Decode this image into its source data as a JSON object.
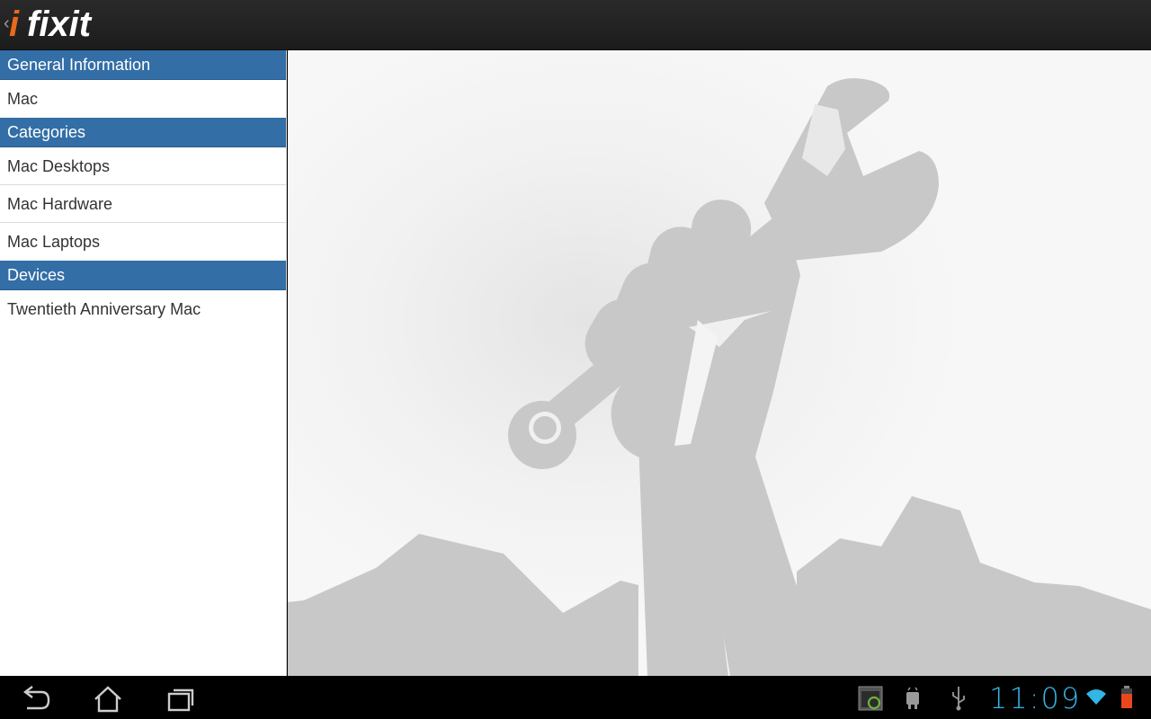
{
  "app": {
    "logo_text": "ifixit",
    "up_caret": "‹",
    "brand_color": "#e86a1c"
  },
  "sidebar": {
    "sections": [
      {
        "header": "General Information",
        "items": [
          "Mac"
        ]
      },
      {
        "header": "Categories",
        "items": [
          "Mac Desktops",
          "Mac Hardware",
          "Mac Laptops"
        ]
      },
      {
        "header": "Devices",
        "items": [
          "Twentieth Anniversary Mac"
        ]
      }
    ],
    "header_color": "#336ea6"
  },
  "hero": {
    "icon": "fist-with-wrench-illustration",
    "shape_color": "#c8c8c8"
  },
  "systembar": {
    "nav_icons": [
      "back-icon",
      "home-icon",
      "recent-apps-icon"
    ],
    "status_icons": [
      "screenshot-notification-icon",
      "usb-debugging-icon",
      "usb-icon",
      "wifi-icon",
      "battery-icon"
    ],
    "clock": "11:09",
    "accent_color": "#33b5e5"
  }
}
